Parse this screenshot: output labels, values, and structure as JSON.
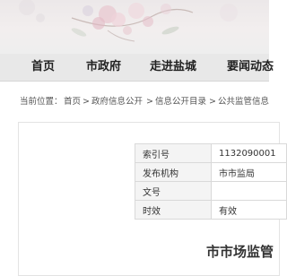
{
  "nav": {
    "items": [
      {
        "label": "首页"
      },
      {
        "label": "市政府"
      },
      {
        "label": "走进盐城"
      },
      {
        "label": "要闻动态"
      }
    ]
  },
  "breadcrumb": {
    "prefix": "当前位置：",
    "items": [
      {
        "label": "首页"
      },
      {
        "label": "政府信息公开"
      },
      {
        "label": "信息公开目录"
      },
      {
        "label": "公共监管信息"
      }
    ],
    "separator": ">"
  },
  "info": {
    "rows": [
      {
        "key": "索引号",
        "value": "1132090001"
      },
      {
        "key": "发布机构",
        "value": "市市监局"
      },
      {
        "key": "文号",
        "value": ""
      },
      {
        "key": "时效",
        "value": "有效"
      }
    ]
  },
  "article": {
    "title": "市市场监管"
  }
}
